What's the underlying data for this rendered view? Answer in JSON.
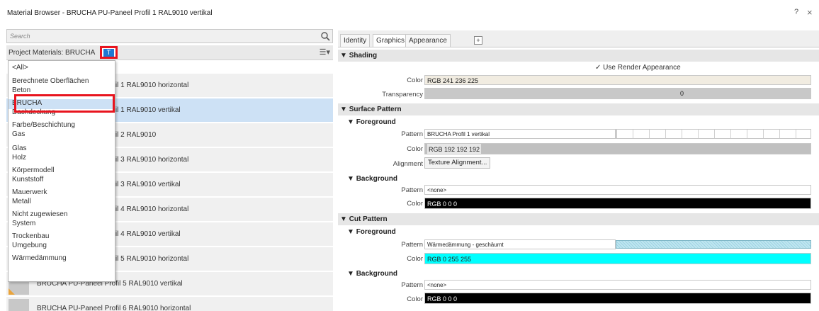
{
  "window": {
    "title": "Material Browser - BRUCHA PU-Paneel Profil 1 RAL9010 vertikal",
    "help": "?",
    "close": "×"
  },
  "left": {
    "search_placeholder": "Search",
    "project_label": "Project Materials: BRUCHA",
    "filter_glyph": "T",
    "materials": [
      {
        "name": "BRUCHA PU-Paneel Profil 1 RAL9010 horizontal"
      },
      {
        "name": "BRUCHA PU-Paneel Profil 1 RAL9010 vertikal"
      },
      {
        "name": "BRUCHA PU-Paneel Profil 2 RAL9010"
      },
      {
        "name": "BRUCHA PU-Paneel Profil 3 RAL9010 horizontal"
      },
      {
        "name": "BRUCHA PU-Paneel Profil 3 RAL9010 vertikal"
      },
      {
        "name": "BRUCHA PU-Paneel Profil 4 RAL9010 horizontal"
      },
      {
        "name": "BRUCHA PU-Paneel Profil 4 RAL9010 vertikal"
      },
      {
        "name": "BRUCHA PU-Paneel Profil 5 RAL9010 horizontal"
      },
      {
        "name": "BRUCHA PU-Paneel Profil 5 RAL9010 vertikal"
      },
      {
        "name": "BRUCHA PU-Paneel Profil 6 RAL9010 horizontal"
      }
    ],
    "filter_options": [
      "<All>",
      "Berechnete Oberflächen",
      "Beton",
      "BRUCHA",
      "Dachdeckung",
      "Farbe/Beschichtung",
      "Gas",
      "Glas",
      "Holz",
      "Körpermodell",
      "Kunststoff",
      "Mauerwerk",
      "Metall",
      "Nicht zugewiesen",
      "System",
      "Trockenbau",
      "Umgebung",
      "Wärmedämmung"
    ],
    "filter_selected": "BRUCHA"
  },
  "right": {
    "tabs": [
      "Identity",
      "Graphics",
      "Appearance"
    ],
    "active_tab": "Graphics",
    "shading": {
      "header": "Shading",
      "use_render_appearance": "Use Render Appearance",
      "color_label": "Color",
      "color_value": "RGB 241 236 225",
      "color_hex": "#f1ece1",
      "transparency_label": "Transparency",
      "transparency_value": "0"
    },
    "surface_pattern": {
      "header": "Surface Pattern",
      "foreground": {
        "header": "Foreground",
        "pattern_label": "Pattern",
        "pattern_value": "BRUCHA Profil 1 vertikal",
        "color_label": "Color",
        "color_value": "RGB 192 192 192",
        "color_hex": "#c0c0c0",
        "alignment_label": "Alignment",
        "alignment_value": "Texture Alignment..."
      },
      "background": {
        "header": "Background",
        "pattern_label": "Pattern",
        "pattern_value": "<none>",
        "color_label": "Color",
        "color_value": "RGB 0 0 0",
        "color_hex": "#000000"
      }
    },
    "cut_pattern": {
      "header": "Cut Pattern",
      "foreground": {
        "header": "Foreground",
        "pattern_label": "Pattern",
        "pattern_value": "Wärmedämmung - geschäumt",
        "color_label": "Color",
        "color_value": "RGB 0 255 255",
        "color_hex": "#00ffff"
      },
      "background": {
        "header": "Background",
        "pattern_label": "Pattern",
        "pattern_value": "<none>",
        "color_label": "Color",
        "color_value": "RGB 0 0 0",
        "color_hex": "#000000"
      }
    }
  }
}
